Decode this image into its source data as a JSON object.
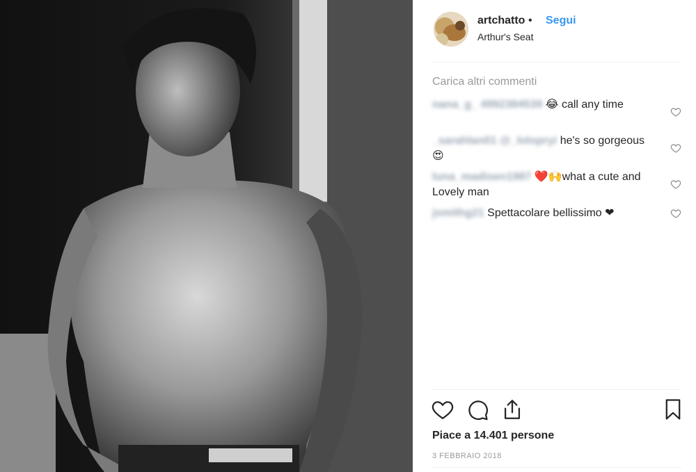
{
  "post": {
    "username": "artchatto",
    "separator": "•",
    "follow_label": "Segui",
    "location": "Arthur's Seat",
    "load_more": "Carica altri commenti",
    "likes_text": "Piace a 14.401 persone",
    "date": "3 FEBBRAIO 2018",
    "accent_color": "#3897f0"
  },
  "comments": [
    {
      "username": "nana_g_ 4992384539",
      "text": "😂 call any time"
    },
    {
      "username": "_sarahlan01 @_lolopryi",
      "text": "he's so gorgeous 😍"
    },
    {
      "username": "luna_madisen1987",
      "text": "❤️🙌what a cute and Lovely man"
    },
    {
      "username": "jsmithg21",
      "text": "Spettacolare bellissimo ❤"
    }
  ],
  "icons": {
    "like": "heart-icon",
    "comment": "comment-icon",
    "share": "share-icon",
    "save": "bookmark-icon"
  }
}
